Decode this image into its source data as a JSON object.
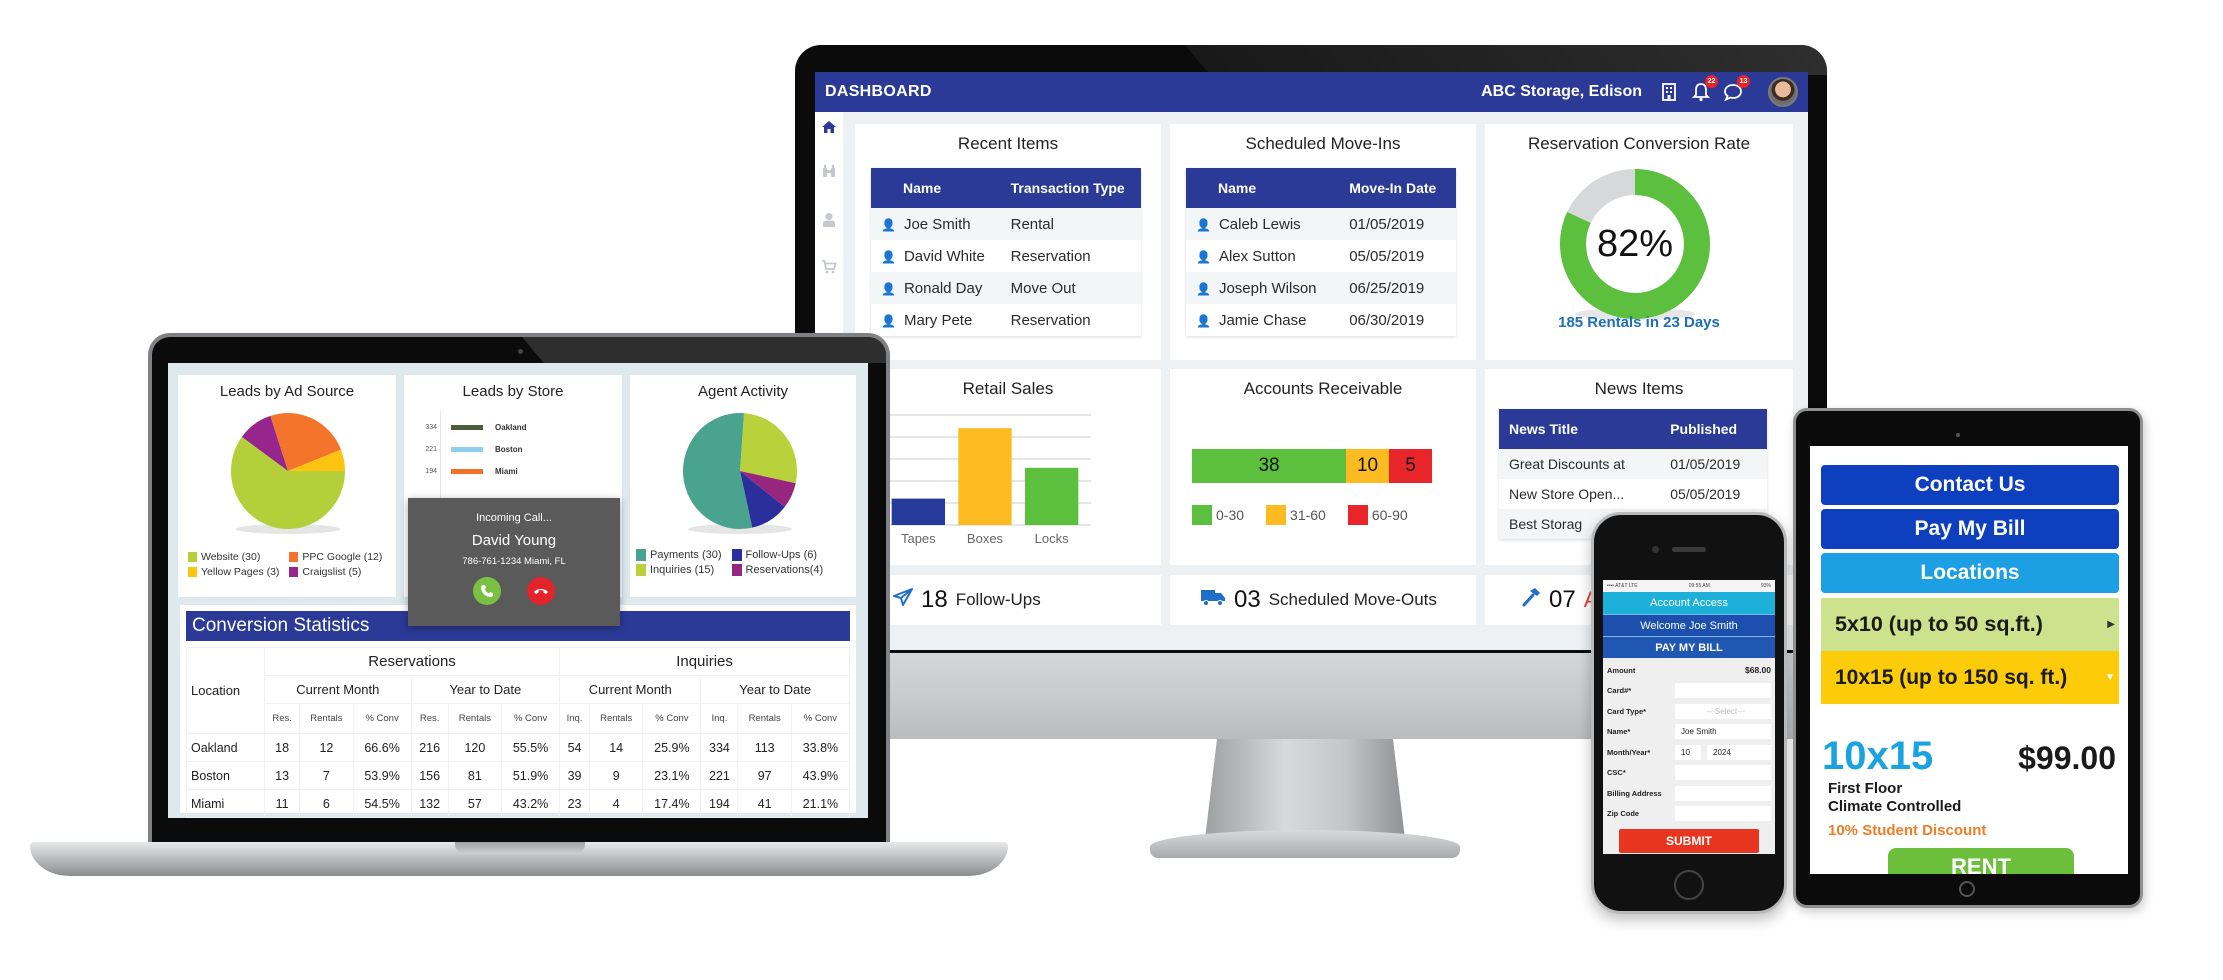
{
  "monitor": {
    "header": {
      "title": "DASHBOARD",
      "store": "ABC Storage, Edison",
      "icons": [
        "building-icon",
        "bell-icon",
        "chat-icon",
        "avatar"
      ],
      "notifications_badge": "22",
      "messages_badge": "13"
    },
    "sidebar": {
      "items": [
        {
          "icon": "home-icon",
          "glyph": "⌂",
          "active": true
        },
        {
          "icon": "binoculars-icon",
          "glyph": "⚲",
          "active": false
        },
        {
          "icon": "user-icon",
          "glyph": "👤",
          "active": false
        },
        {
          "icon": "cart-icon",
          "glyph": "🛒",
          "active": false
        }
      ]
    },
    "recent_items": {
      "title": "Recent Items",
      "columns": [
        "Name",
        "Transaction Type"
      ],
      "rows": [
        [
          "Joe Smith",
          "Rental"
        ],
        [
          "David White",
          "Reservation"
        ],
        [
          "Ronald Day",
          "Move Out"
        ],
        [
          "Mary Pete",
          "Reservation"
        ]
      ]
    },
    "scheduled_move_ins": {
      "title": "Scheduled Move-Ins",
      "columns": [
        "Name",
        "Move-In Date"
      ],
      "rows": [
        [
          "Caleb Lewis",
          "01/05/2019"
        ],
        [
          "Alex Sutton",
          "05/05/2019"
        ],
        [
          "Joseph Wilson",
          "06/25/2019"
        ],
        [
          "Jamie Chase",
          "06/30/2019"
        ]
      ]
    },
    "conversion_rate": {
      "title": "Reservation Conversion Rate",
      "value_label": "82%",
      "percent": 82,
      "caption": "185 Rentals in 23 Days",
      "colors": {
        "filled": "#5cbf3d",
        "rest": "#d6d8da"
      }
    },
    "accounts_receivable": {
      "title": "Accounts Receivable",
      "segments": [
        {
          "label": "0-30",
          "value": 38,
          "color": "#5cbf3d"
        },
        {
          "label": "31-60",
          "value": 10,
          "color": "#fbbb21"
        },
        {
          "label": "60-90",
          "value": 5,
          "color": "#e8262a"
        }
      ]
    },
    "news_items": {
      "title": "News Items",
      "columns": [
        "News Title",
        "Published"
      ],
      "rows": [
        [
          "Great Discounts at",
          "01/05/2019"
        ],
        [
          "New Store Open...",
          "05/05/2019"
        ],
        [
          "Best Storag",
          ""
        ]
      ]
    },
    "stats": [
      {
        "icon": "paper-plane-icon",
        "glyph": "✈",
        "number": "18",
        "label": "Follow-Ups"
      },
      {
        "icon": "truck-icon",
        "glyph": "🚚",
        "number": "03",
        "label": "Scheduled Move-Outs"
      },
      {
        "icon": "hammer-icon",
        "glyph": "⚒",
        "number": "07",
        "label": "A"
      }
    ]
  },
  "chart_data": [
    {
      "type": "bar",
      "title": "Retail Sales",
      "categories": [
        "Tapes",
        "Boxes",
        "Locks"
      ],
      "values": [
        12,
        44,
        26
      ],
      "colors": [
        "#263a9c",
        "#fbbb21",
        "#5cbf3d"
      ],
      "yticks": [
        0,
        10,
        20,
        30,
        40,
        50
      ],
      "ylim": [
        0,
        50
      ],
      "xlabel": "",
      "ylabel": "",
      "grid": true
    },
    {
      "type": "pie",
      "title": "Leads by Ad Source",
      "labels": [
        "Website (30)",
        "PPC Google (12)",
        "Yellow Pages (3)",
        "Craigslist (5)"
      ],
      "values": [
        30,
        12,
        3,
        5
      ],
      "colors": [
        "#b5cf3a",
        "#f3742a",
        "#fec40f",
        "#96268d"
      ],
      "legend": "bottom"
    },
    {
      "type": "pie",
      "title": "Agent Activity",
      "labels": [
        "Payments (30)",
        "Follow-Ups (6)",
        "Inquiries (15)",
        "Reservations(4)"
      ],
      "values": [
        30,
        6,
        15,
        4
      ],
      "colors": [
        "#4aa38e",
        "#2b2f9b",
        "#b9d23c",
        "#98267f"
      ],
      "legend": "bottom"
    },
    {
      "type": "line",
      "title": "Leads by Store",
      "series": [
        {
          "name": "Oakland",
          "value": 334,
          "color": "#4b5d3a"
        },
        {
          "name": "Boston",
          "value": 221,
          "color": "#8fd0f0"
        },
        {
          "name": "Miami",
          "value": 194,
          "color": "#f07128"
        }
      ],
      "legend": "inside"
    }
  ],
  "laptop": {
    "titles": {
      "ad_source": "Leads by Ad Source",
      "store": "Leads by Store",
      "agent": "Agent Activity"
    },
    "incoming_call": {
      "status": "Incoming Call...",
      "name": "David Young",
      "info": "786-761-1234 Miami, FL",
      "accept_icon": "phone-accept-icon",
      "decline_icon": "phone-decline-icon"
    },
    "conversion_stats": {
      "title": "Conversion Statistics",
      "group_headers": [
        "Reservations",
        "Inquiries"
      ],
      "period_headers": [
        "Current Month",
        "Year to Date",
        "Current Month",
        "Year to Date"
      ],
      "location_header": "Location",
      "sub_headers": [
        "Res.",
        "Rentals",
        "% Conv",
        "Res.",
        "Rentals",
        "% Conv",
        "Inq.",
        "Rentals",
        "% Conv",
        "Inq.",
        "Rentals",
        "% Conv"
      ],
      "rows": [
        [
          "Oakland",
          "18",
          "12",
          "66.6%",
          "216",
          "120",
          "55.5%",
          "54",
          "14",
          "25.9%",
          "334",
          "113",
          "33.8%"
        ],
        [
          "Boston",
          "13",
          "7",
          "53.9%",
          "156",
          "81",
          "51.9%",
          "39",
          "9",
          "23.1%",
          "221",
          "97",
          "43.9%"
        ],
        [
          "Miami",
          "11",
          "6",
          "54.5%",
          "132",
          "57",
          "43.2%",
          "23",
          "4",
          "17.4%",
          "194",
          "41",
          "21.1%"
        ]
      ]
    }
  },
  "phone": {
    "status": {
      "carrier": "•••• AT&T LTE",
      "time": "09:55 AM",
      "battery": "93%"
    },
    "account_access": "Account Access",
    "welcome": "Welcome Joe Smith",
    "pay_bill": "PAY MY BILL",
    "amount_label": "Amount",
    "amount_value": "$68.00",
    "fields": [
      {
        "label": "Card#*",
        "value": ""
      },
      {
        "label": "Card Type*",
        "value": "---Select---"
      },
      {
        "label": "Name*",
        "value": "Joe Smith"
      },
      {
        "label": "Month/Year*",
        "value": "10",
        "value2": "2024"
      },
      {
        "label": "CSC*",
        "value": ""
      },
      {
        "label": "Billing Address",
        "value": ""
      },
      {
        "label": "Zip Code",
        "value": ""
      }
    ],
    "submit": "SUBMIT"
  },
  "tablet": {
    "buttons": [
      "Contact Us",
      "Pay My Bill",
      "Locations"
    ],
    "options": [
      "5x10  (up to 50 sq.ft.)",
      "10x15 (up to 150 sq. ft.)"
    ],
    "unit_size": "10x15",
    "price": "$99.00",
    "features": [
      "First Floor",
      "Climate Controlled"
    ],
    "discount": "10% Student Discount",
    "rent": "RENT"
  }
}
